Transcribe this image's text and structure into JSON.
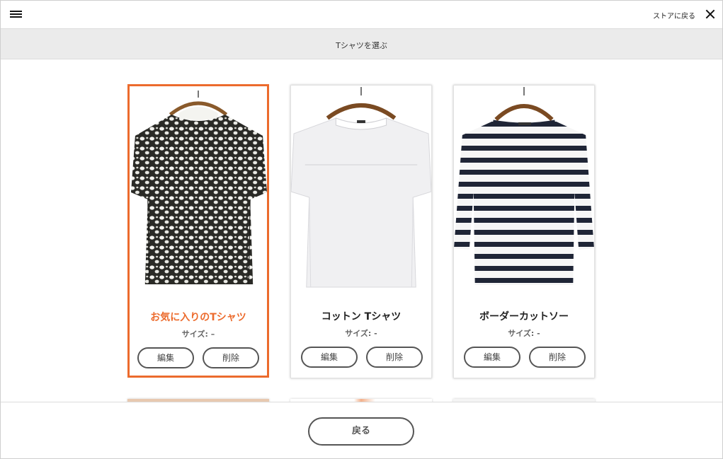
{
  "header": {
    "menu_icon": "hamburger-menu-icon",
    "back_to_store": "ストアに戻る",
    "close_icon": "close-icon"
  },
  "subheader": {
    "title": "Tシャツを選ぶ"
  },
  "items": [
    {
      "name": "お気に入りのTシャツ",
      "size": "サイズ: –",
      "edit": "編集",
      "delete": "削除",
      "selected": true,
      "image": "leopard-print-tshirt-photo"
    },
    {
      "name": "コットン Tシャツ",
      "size": "サイズ: -",
      "edit": "編集",
      "delete": "削除",
      "selected": false,
      "image": "white-cotton-tshirt-photo"
    },
    {
      "name": "ボーダーカットソー",
      "size": "サイズ: -",
      "edit": "編集",
      "delete": "削除",
      "selected": false,
      "image": "navy-striped-boatneck-photo"
    }
  ],
  "footer": {
    "back_label": "戻る"
  },
  "colors": {
    "accent": "#ec6b2d",
    "subheader_bg": "#ebebeb",
    "stripe_navy": "#1f2536"
  }
}
